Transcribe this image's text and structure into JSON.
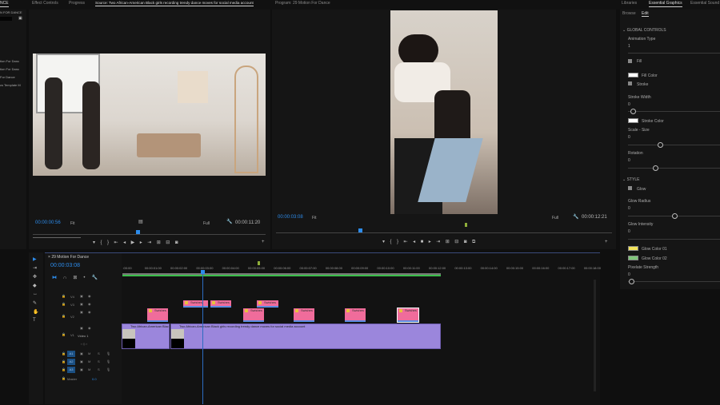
{
  "top_tabs": {
    "project": "NCE",
    "effect_controls": "Effect Controls",
    "progress": "Progress",
    "source": "Source: Two African-American Black girls recording trendy dance moves for social media account",
    "program": "Program: 29 Motion For Dance",
    "libraries": "Libraries",
    "essential_graphics": "Essential Graphics",
    "essential_sound": "Essential Sound"
  },
  "project_panel": {
    "title": "N FOR DANCE",
    "items": [
      "tion For Danc",
      "tion For Danc",
      "For Dance",
      "cs Template M"
    ]
  },
  "source": {
    "timecode": "00:00:00:56",
    "zoom": "Fit",
    "resolution": "Full",
    "duration": "00:00:11:20",
    "playhead_fraction": 0.45
  },
  "program": {
    "timecode": "00:00:03:08",
    "zoom": "Fit",
    "resolution": "Full",
    "duration": "00:00:12:21",
    "playhead_fraction": 0.25
  },
  "timeline": {
    "sequence_name": "29 Motion For Dance",
    "timecode": "00:00:03:08",
    "ruler": [
      ":00:00",
      "00:00:01:00",
      "00:00:02:00",
      "00:00:03:00",
      "00:00:04:00",
      "00:00:05:00",
      "00:00:06:00",
      "00:00:07:00",
      "00:00:08:00",
      "00:00:09:00",
      "00:00:10:00",
      "00:00:11:00",
      "00:00:12:00",
      "00:00:13:00",
      "00:00:14:00",
      "00:00:15:00",
      "00:00:16:00",
      "00:00:17:00",
      "00:00:18:00"
    ],
    "tracks": {
      "v4": "V4",
      "v3": "V3",
      "v2": "V2",
      "v1": "V1",
      "v1_name": "Video 1",
      "a1": "A1",
      "a2": "A2",
      "a3": "A3",
      "master": "Master",
      "master_value": "0.0",
      "mute": "M",
      "solo": "S"
    },
    "graphic_clip_label": "Swishes",
    "video_clip_1": "Two African-American Black",
    "video_clip_2": "Two African-American Black girls recording trendy dance moves for social media account"
  },
  "essential_graphics": {
    "browse": "Browse",
    "edit": "Edit",
    "global_controls": "GLOBAL CONTROLS",
    "animation_type": "Animation Type",
    "animation_type_value": "1",
    "fill": "Fill",
    "fill_color": "Fill Color",
    "stroke": "Stroke",
    "stroke_width": "Stroke Width",
    "stroke_width_value": "0",
    "stroke_color": "Stroke Color",
    "scale_size": "Scale - Size",
    "scale_size_value": "0",
    "rotation": "Rotation",
    "rotation_value": "0",
    "style": "STYLE",
    "glow": "Glow",
    "glow_radius": "Glow Radius",
    "glow_radius_value": "0",
    "glow_intensity": "Glow Intensity",
    "glow_intensity_value": "0",
    "glow_color_1": "Glow Color 01",
    "glow_color_2": "Glow Color 02",
    "pixelate_strength": "Pixelate Strength",
    "pixelate_strength_value": "0",
    "colors": {
      "fill": "#ffffff",
      "stroke": "#ffffff",
      "glow1": "#f2e35a",
      "glow2": "#7fc57a"
    }
  },
  "colors": {
    "accent": "#2d8ceb",
    "graphic_clip": "#f06c9b",
    "video_clip": "#9b86dc"
  }
}
